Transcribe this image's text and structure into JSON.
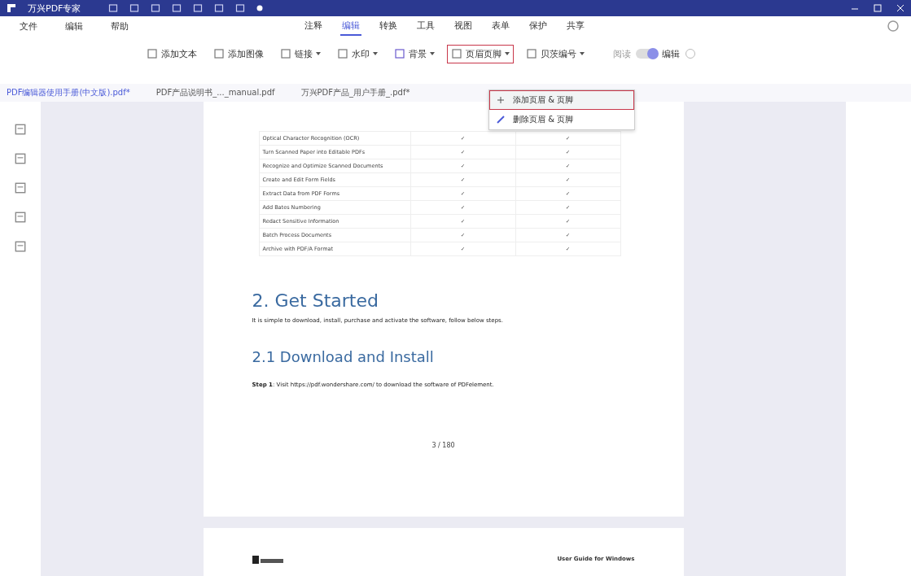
{
  "window": {
    "title": "万兴PDF专家"
  },
  "menu": [
    "文件",
    "编辑",
    "帮助"
  ],
  "tabs": [
    {
      "label": "注释",
      "selected": false
    },
    {
      "label": "编辑",
      "selected": true
    },
    {
      "label": "转换",
      "selected": false
    },
    {
      "label": "工具",
      "selected": false
    },
    {
      "label": "视图",
      "selected": false
    },
    {
      "label": "表单",
      "selected": false
    },
    {
      "label": "保护",
      "selected": false
    },
    {
      "label": "共享",
      "selected": false
    }
  ],
  "toolbar": [
    {
      "label": "添加文本",
      "dropdown": false,
      "open": false
    },
    {
      "label": "添加图像",
      "dropdown": false,
      "open": false
    },
    {
      "label": "链接",
      "dropdown": true,
      "open": false
    },
    {
      "label": "水印",
      "dropdown": true,
      "open": false
    },
    {
      "label": "背景",
      "dropdown": true,
      "open": false
    },
    {
      "label": "页眉页脚",
      "dropdown": true,
      "open": true
    },
    {
      "label": "贝茨编号",
      "dropdown": true,
      "open": false
    }
  ],
  "mode": {
    "left": "阅读",
    "right": "编辑",
    "on": true
  },
  "doc_tabs": [
    {
      "label": "PDF编辑器使用手册(中文版).pdf*",
      "selected": true
    },
    {
      "label": "PDF产品说明书_..._manual.pdf",
      "selected": false
    },
    {
      "label": "万兴PDF产品_用户手册_.pdf*",
      "selected": false
    }
  ],
  "dropdown": [
    {
      "label": "添加页眉 & 页脚",
      "kind": "add",
      "selected": true
    },
    {
      "label": "删除页眉 & 页脚",
      "kind": "remove",
      "selected": false
    }
  ],
  "table_rows": [
    {
      "feature": "Optical Character Recognition (OCR)",
      "col_2": "✓",
      "col_3": "✓"
    },
    {
      "feature": "Turn Scanned Paper into Editable PDFs",
      "col_2": "✓",
      "col_3": "✓"
    },
    {
      "feature": "Recognize and Optimize Scanned Documents",
      "col_2": "✓",
      "col_3": "✓"
    },
    {
      "feature": "Create and Edit Form Fields",
      "col_2": "✓",
      "col_3": "✓"
    },
    {
      "feature": "Extract Data from PDF Forms",
      "col_2": "✓",
      "col_3": "✓"
    },
    {
      "feature": "Add Bates Numbering",
      "col_2": "✓",
      "col_3": "✓"
    },
    {
      "feature": "Redact Sensitive Information",
      "col_2": "✓",
      "col_3": "✓"
    },
    {
      "feature": "Batch Process Documents",
      "col_2": "✓",
      "col_3": "✓"
    },
    {
      "feature": "Archive with PDF/A Format",
      "col_2": "✓",
      "col_3": "✓"
    }
  ],
  "heading": "2. Get Started",
  "intro": "It is simple to download, install, purchase and activate the software, follow below steps.",
  "subheading": "2.1 Download and Install",
  "step": "**Step 1**: Visit https://pdf.wondershare.com/ to download the software of PDFelement.",
  "page_number": "3 / 180",
  "next_page_header": "User Guide for Windows"
}
